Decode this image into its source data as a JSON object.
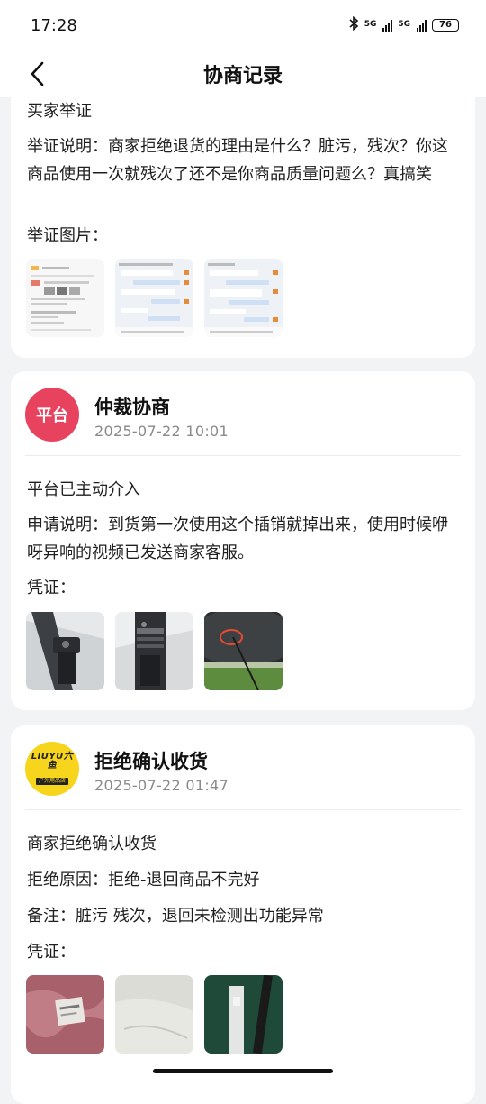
{
  "status_bar": {
    "time": "17:28",
    "net1": "5G",
    "net2": "5G",
    "battery": "76"
  },
  "nav": {
    "title": "协商记录"
  },
  "buyer_card": {
    "heading": "买家举证",
    "description": "举证说明：商家拒绝退货的理由是什么？脏污，残次？你这商品使用一次就残次了还不是你商品质量问题么？真搞笑",
    "images_label": "举证图片："
  },
  "platform_card": {
    "avatar_text": "平台",
    "title": "仲裁协商",
    "time": "2025-07-22 10:01",
    "line1": "平台已主动介入",
    "description": "申请说明：到货第一次使用这个插销就掉出来，使用时候咿呀异响的视频已发送商家客服。",
    "evidence_label": "凭证："
  },
  "merchant_card": {
    "brand_name": "LIUYU六鱼",
    "brand_sub": "户外用品店",
    "title": "拒绝确认收货",
    "time": "2025-07-22 01:47",
    "line1": "商家拒绝确认收货",
    "reason": "拒绝原因：拒绝-退回商品不完好",
    "note": "备注：脏污 残次，退回未检测出功能异常",
    "evidence_label": "凭证："
  },
  "icons": [
    "bluetooth-icon",
    "signal-icon",
    "battery-icon",
    "back-arrow-icon"
  ],
  "colors": {
    "platform_avatar": "#e8435e",
    "brand_avatar": "#f7d51c",
    "background": "#f2f3f5"
  }
}
